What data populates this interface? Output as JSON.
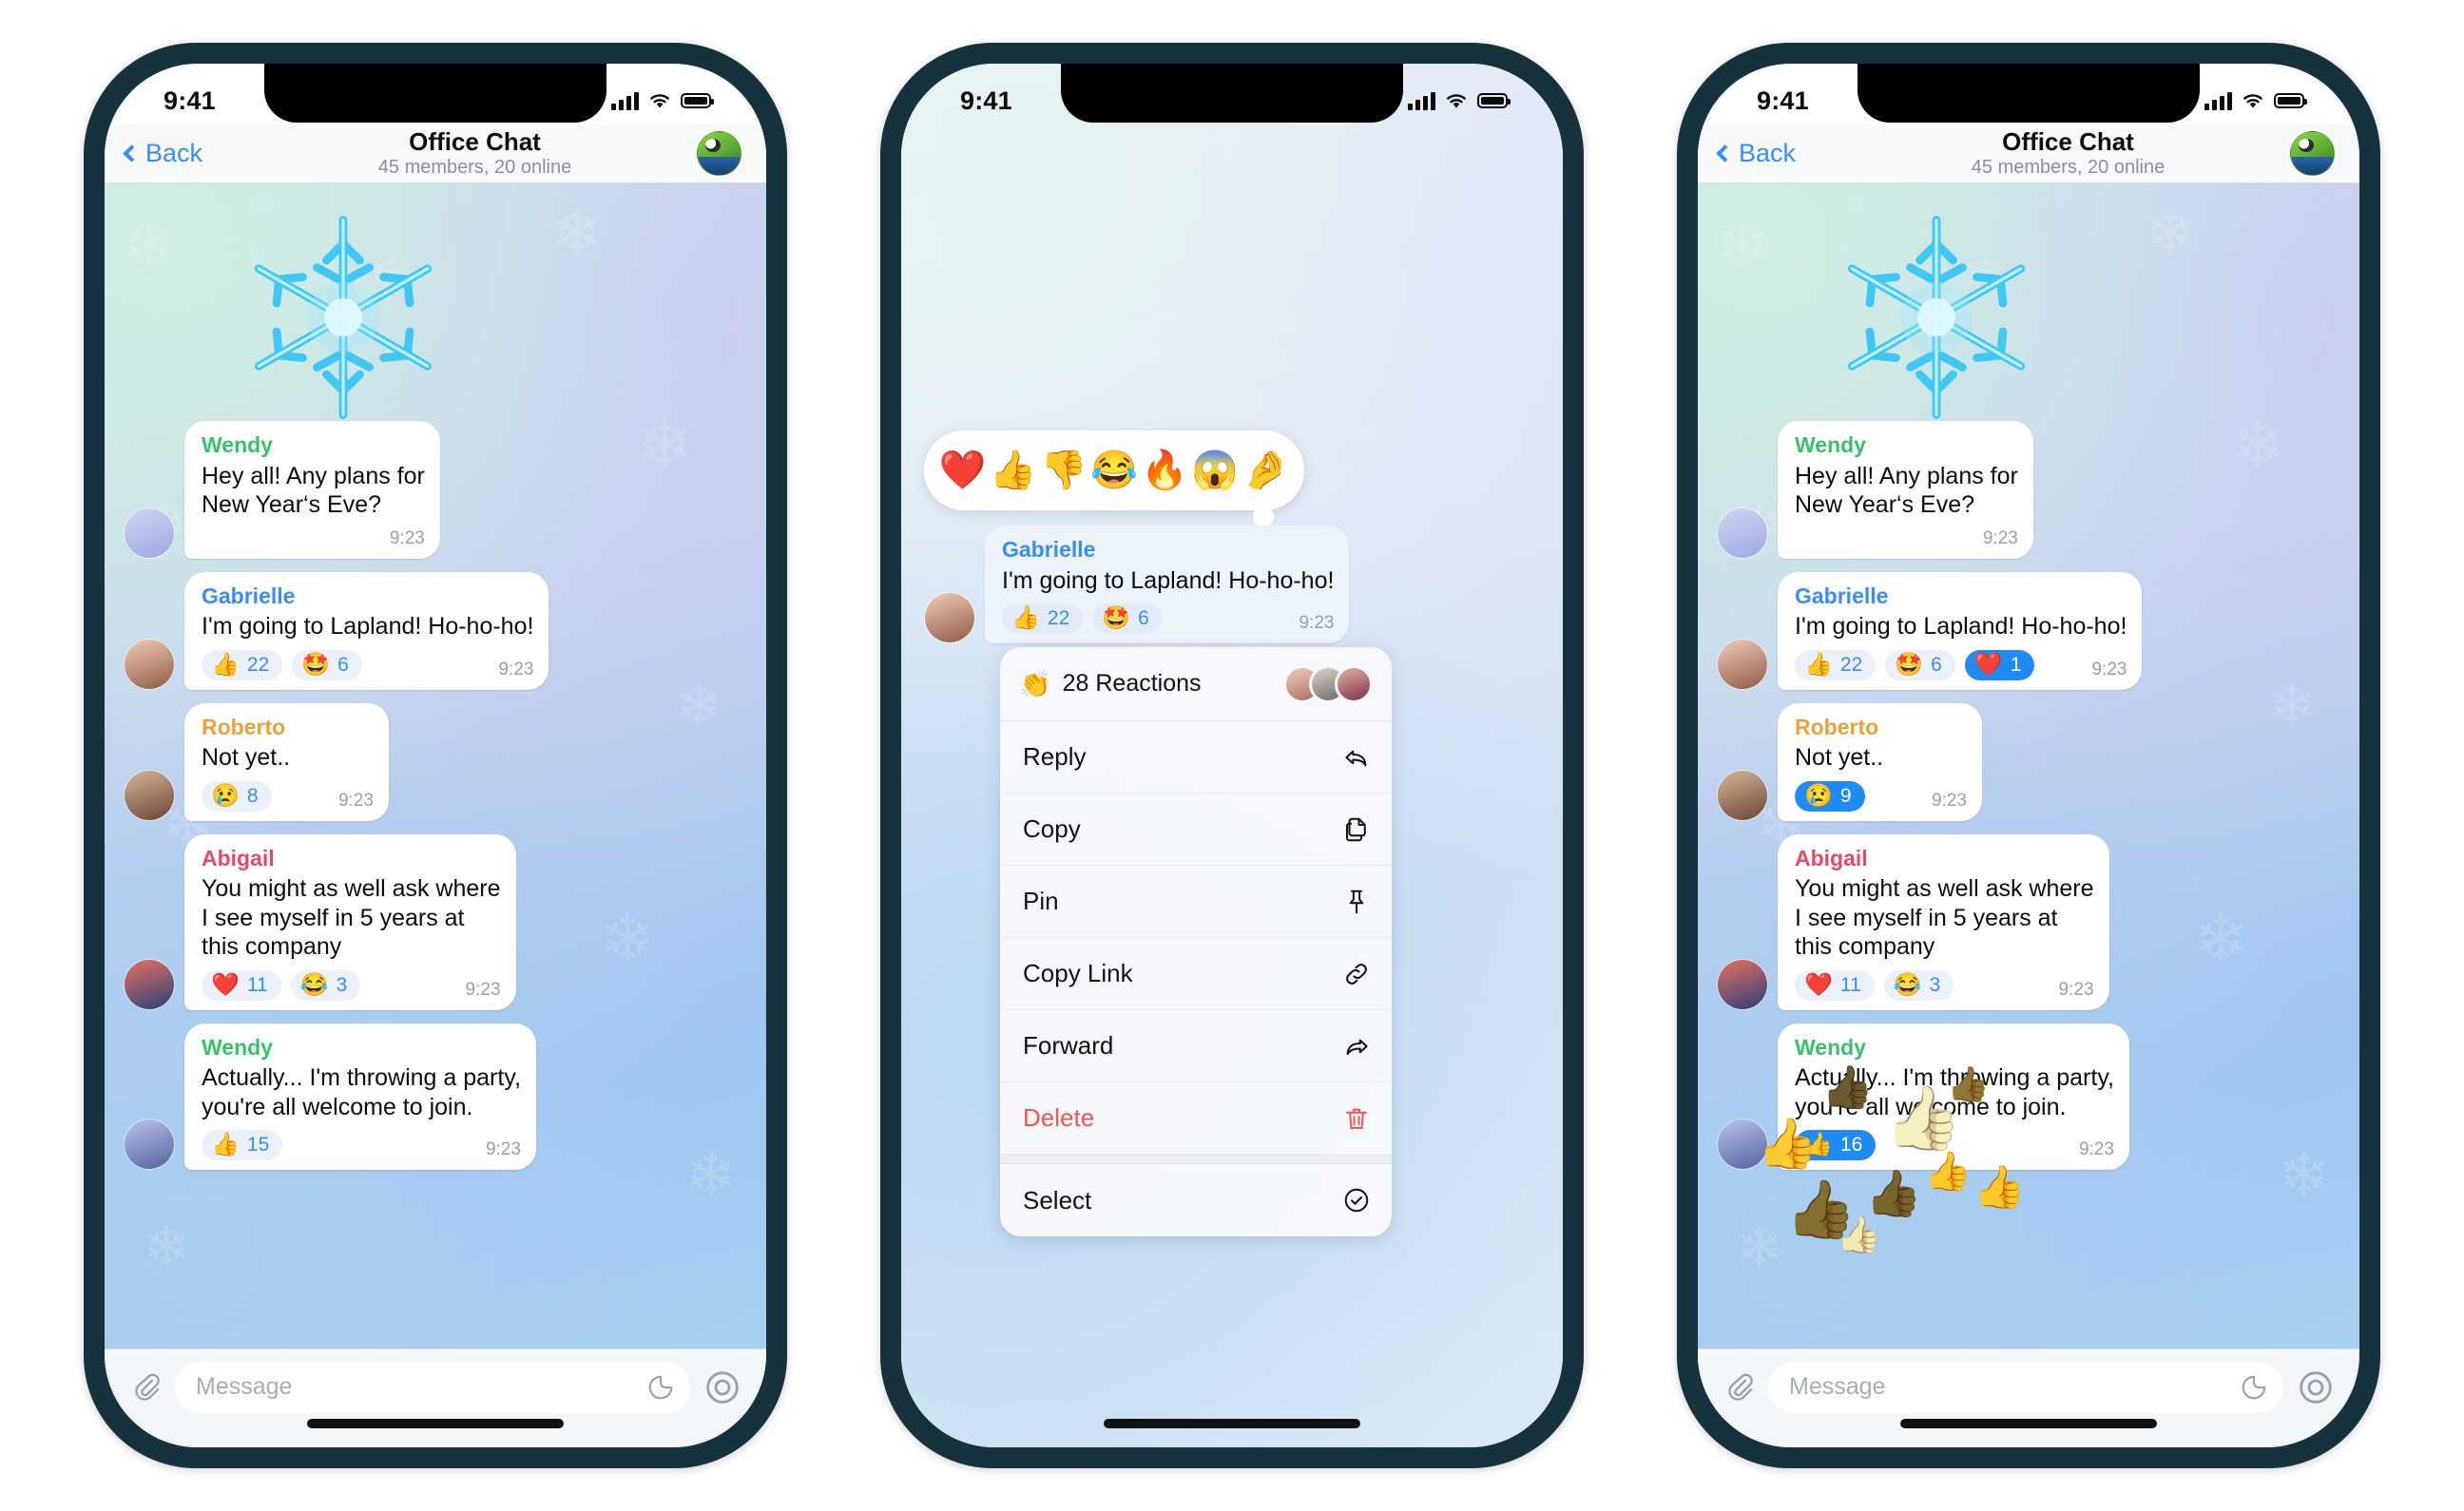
{
  "status": {
    "time": "9:41",
    "signal_icon": "cellular-bars-icon",
    "wifi_icon": "wifi-icon",
    "battery_icon": "battery-full-icon"
  },
  "nav": {
    "back_label": "Back",
    "title": "Office Chat",
    "subtitle": "45 members, 20 online",
    "avatar_name": "chat-avatar"
  },
  "colors": {
    "accent_blue": "#3a8df7",
    "active_pill": "#1f8bf5",
    "sender_wendy": "#39c16c",
    "sender_gabrielle": "#3a8df7",
    "sender_roberto": "#e8a33d",
    "sender_abigail": "#e24a6e",
    "delete_red": "#f0554f"
  },
  "composer": {
    "placeholder": "Message",
    "attach_icon": "paperclip-icon",
    "sticker_icon": "sticker-icon",
    "voice_icon": "voice-record-icon"
  },
  "sticker": {
    "name": "neon-snowflake-sticker"
  },
  "phone1": {
    "messages": [
      {
        "sender": "Wendy",
        "sender_color": "#39c16c",
        "text": "Hey all! Any plans for\nNew Year‘s Eve?",
        "time": "9:23",
        "reactions": []
      },
      {
        "sender": "Gabrielle",
        "sender_color": "#3a8df7",
        "text": "I'm going to Lapland! Ho-ho-ho!",
        "time": "9:23",
        "reactions": [
          {
            "emoji": "👍",
            "count": "22",
            "active": false
          },
          {
            "emoji": "🤩",
            "count": "6",
            "active": false
          }
        ]
      },
      {
        "sender": "Roberto",
        "sender_color": "#e8a33d",
        "text": "Not yet..",
        "time": "9:23",
        "reactions": [
          {
            "emoji": "😢",
            "count": "8",
            "active": false
          }
        ]
      },
      {
        "sender": "Abigail",
        "sender_color": "#e24a6e",
        "text": "You might as well ask where\nI see myself in 5 years at\nthis company",
        "time": "9:23",
        "reactions": [
          {
            "emoji": "❤️",
            "count": "11",
            "active": false
          },
          {
            "emoji": "😂",
            "count": "3",
            "active": false
          }
        ]
      },
      {
        "sender": "Wendy",
        "sender_color": "#39c16c",
        "text": "Actually... I'm throwing a party,\nyou're all welcome to join.",
        "time": "9:23",
        "reactions": [
          {
            "emoji": "👍",
            "count": "15",
            "active": false
          }
        ]
      }
    ]
  },
  "phone2": {
    "reaction_picker": [
      "❤️",
      "👍",
      "👎",
      "😂",
      "🔥",
      "😱",
      "🤌"
    ],
    "focused_message": {
      "sender": "Gabrielle",
      "sender_color": "#3a8df7",
      "text": "I'm going to Lapland! Ho-ho-ho!",
      "time": "9:23",
      "reactions": [
        {
          "emoji": "👍",
          "count": "22",
          "active": false
        },
        {
          "emoji": "🤩",
          "count": "6",
          "active": false
        }
      ]
    },
    "context_menu": {
      "header": {
        "emoji": "👏",
        "label": "28 Reactions",
        "facepile_name": "reactors-facepile"
      },
      "items": [
        {
          "label": "Reply",
          "icon": "reply-arrow-icon",
          "danger": false
        },
        {
          "label": "Copy",
          "icon": "copy-icon",
          "danger": false
        },
        {
          "label": "Pin",
          "icon": "pin-icon",
          "danger": false
        },
        {
          "label": "Copy Link",
          "icon": "link-icon",
          "danger": false
        },
        {
          "label": "Forward",
          "icon": "forward-arrow-icon",
          "danger": false
        },
        {
          "label": "Delete",
          "icon": "trash-icon",
          "danger": true
        },
        {
          "label": "Select",
          "icon": "check-circle-icon",
          "danger": false
        }
      ]
    }
  },
  "phone3": {
    "messages": [
      {
        "sender": "Wendy",
        "sender_color": "#39c16c",
        "text": "Hey all! Any plans for\nNew Year‘s Eve?",
        "time": "9:23",
        "reactions": []
      },
      {
        "sender": "Gabrielle",
        "sender_color": "#3a8df7",
        "text": "I'm going to Lapland! Ho-ho-ho!",
        "time": "9:23",
        "reactions": [
          {
            "emoji": "👍",
            "count": "22",
            "active": false
          },
          {
            "emoji": "🤩",
            "count": "6",
            "active": false
          },
          {
            "emoji": "❤️",
            "count": "1",
            "active": true
          }
        ]
      },
      {
        "sender": "Roberto",
        "sender_color": "#e8a33d",
        "text": "Not yet..",
        "time": "9:23",
        "reactions": [
          {
            "emoji": "😢",
            "count": "9",
            "active": true
          }
        ]
      },
      {
        "sender": "Abigail",
        "sender_color": "#e24a6e",
        "text": "You might as well ask where\nI see myself in 5 years at\nthis company",
        "time": "9:23",
        "reactions": [
          {
            "emoji": "❤️",
            "count": "11",
            "active": false
          },
          {
            "emoji": "😂",
            "count": "3",
            "active": false
          }
        ]
      },
      {
        "sender": "Wendy",
        "sender_color": "#39c16c",
        "text": "Actually... I'm throwing a party,\nyou're all welcome to join.",
        "time": "9:23",
        "reactions": [
          {
            "emoji": "👍",
            "count": "16",
            "active": true
          }
        ]
      }
    ],
    "burst_emoji": "👍"
  }
}
